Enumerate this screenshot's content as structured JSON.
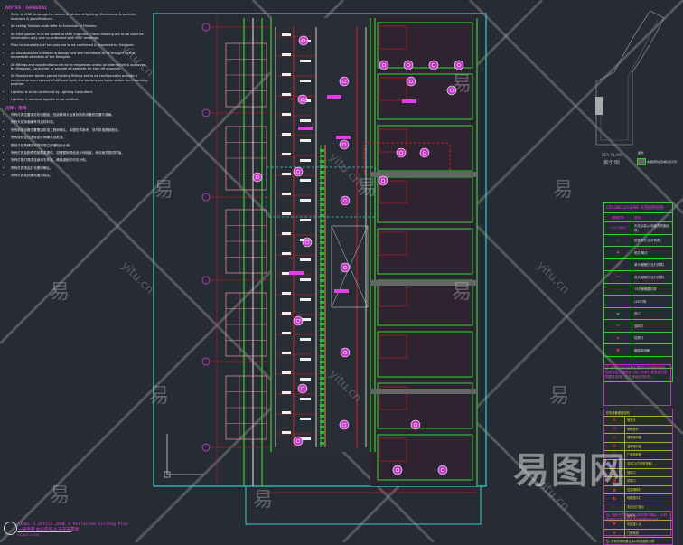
{
  "notes_general": {
    "heading": "NOTES : GENERAL",
    "items": [
      "Refer to M&E drawings for extent of all event lighting, Mechanical & sprinkler locations & specifications.",
      "All ceiling finishes code refer to Schedule of Finishes.",
      "All M&E spotter is to be coded to M&E Engineer. These drawing are to be used for information only and co-ordinated with M&E drawings.",
      "Prior to installation of set-outs are to be confirmed & approved by Designer.",
      "All discrepancies between drawings and site conditions to be brought to the immediate attention of the Designer.",
      "All fittings and coordinations are to be requested unless an alternative is approved by Designer. Contractor to provide all samples for sign off approval.",
      "All fluorescent batten paired lighting fittings are to be configured to provide a continuous even spread of diffused light, the battens are to be visible from standing position.",
      "Lighting is to be confirmed by Lighting Consultant.",
      "Lighting + services layouts to be verified."
    ]
  },
  "notes_cn": {
    "heading": "注释 : 常规",
    "items": [
      "所有灯具位置详见机电图纸，包括喷淋头及其他机电设备的位置与规格。",
      "所有天花饰面编号详见材料表。",
      "所有机电设备位置需由机电工程师确认，本图仅供参考，须与机电图纸配合。",
      "所有放线定位须经设计师确认及批准。",
      "图纸与现场情况不符时须立即通知设计师。",
      "所有灯具及配件须按要求提供，如需替换须经设计师批准。承包商须提供样板。",
      "所有灯管灯具须连续均匀布置，确保漫射光均匀分布。",
      "所有灯具须由灯光顾问确认。",
      "所有灯具及设备布置须核实。"
    ]
  },
  "title_block": {
    "title_en": "LEVEL 1 OFFICE ZONE A Reflected Ceiling Plan",
    "title_cn": "一层平面 办公区域 A 天花布置图",
    "scale": "SCALE 1:100"
  },
  "key_plan": {
    "label_en": "KEY PLAN",
    "label_cn": "索引图",
    "note": "图例:",
    "swatch_label": "本图纸所在区域位置示意"
  },
  "ceiling_legend": {
    "title": "CEILING LEGEND 天花图例说明",
    "col_symbol": "图例符号",
    "col_desc": "说明",
    "rows": [
      {
        "symbol": "+CL-3000",
        "desc": "天花标高(从地面完成面起算)"
      },
      {
        "symbol": "◎",
        "desc": "防雾筒灯(见灯具表)"
      },
      {
        "symbol": "◉",
        "desc": "射灯/筒灯"
      },
      {
        "symbol": "▫",
        "desc": "单头格栅灯(见灯具表)"
      },
      {
        "symbol": "▫▫",
        "desc": "双头格栅灯(见灯具表)"
      },
      {
        "symbol": "—",
        "desc": "T5灯管暗藏灯带"
      },
      {
        "symbol": "- -",
        "desc": "LED灯带"
      },
      {
        "symbol": "▬",
        "desc": "风口"
      },
      {
        "symbol": "▭",
        "desc": "回风口"
      },
      {
        "symbol": "▣",
        "desc": "检修口"
      },
      {
        "symbol": "■",
        "desc": "烟感探测器"
      },
      {
        "symbol": "",
        "desc": ""
      },
      {
        "symbol": "",
        "desc": ""
      }
    ],
    "note": "注: 所有灯具及设备位置须与机电图纸配合，如有冲突须通知设计师。所有灯具需按灯具表要求选用，天花饰面见材料表。"
  },
  "mep_legend": {
    "title": "机电设备图例说明",
    "rows": [
      {
        "symbol": "⊗",
        "desc": "喷淋头"
      },
      {
        "symbol": "⊡",
        "desc": "侧喷淋头"
      },
      {
        "symbol": "⊙",
        "desc": "烟感探测器"
      },
      {
        "symbol": "⊞",
        "desc": "温感探测器"
      },
      {
        "symbol": "◫",
        "desc": "广播扬声器"
      },
      {
        "symbol": "▤",
        "desc": "送风口(方形散流器)"
      },
      {
        "symbol": "▥",
        "desc": "回风口"
      },
      {
        "symbol": "▦",
        "desc": "排风口"
      },
      {
        "symbol": "▲",
        "desc": "应急照明灯"
      },
      {
        "symbol": "◣",
        "desc": "疏散指示灯"
      },
      {
        "symbol": "⊢",
        "desc": "安全出口指示"
      },
      {
        "symbol": "⊥",
        "desc": "摄像头"
      },
      {
        "symbol": "✱",
        "desc": "无线接入点"
      },
      {
        "symbol": "◈",
        "desc": "门禁系统"
      }
    ],
    "footer": "注: 所有机电设备位置以机电图纸为准",
    "note": "注: 所有天花图例须由机电顾问确认，以机电图纸为准，如有冲突请通知设计师。"
  },
  "watermark": {
    "site": "yitu.cn",
    "char": "易",
    "brand": "易图网"
  },
  "colors": {
    "background": "#272b33",
    "frame": "#33cccc",
    "wall": "#33bb33",
    "accent": "#e040e0",
    "red": "#cc2222"
  }
}
